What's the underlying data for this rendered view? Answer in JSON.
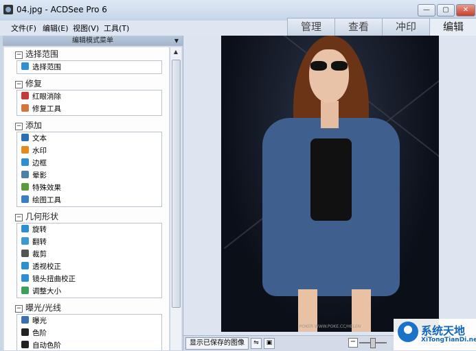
{
  "window": {
    "title": "04.jpg - ACDSee Pro 6",
    "minimize": "—",
    "maximize": "▢",
    "close": "✕"
  },
  "menu": [
    "文件(F)",
    "编辑(E)",
    "视图(V)",
    "工具(T)"
  ],
  "mode_tabs": [
    "管理",
    "查看",
    "冲印",
    "编辑"
  ],
  "active_mode": "编辑",
  "panel": {
    "title": "编辑模式菜单",
    "sections": [
      {
        "title": "选择范围",
        "tools": [
          {
            "label": "选择范围",
            "icon": "selection-icon",
            "color": "#2c8fd1"
          }
        ]
      },
      {
        "title": "修复",
        "tools": [
          {
            "label": "红眼消除",
            "icon": "eye-icon",
            "color": "#c63a3a"
          },
          {
            "label": "修复工具",
            "icon": "bandage-icon",
            "color": "#d4763a"
          }
        ]
      },
      {
        "title": "添加",
        "tools": [
          {
            "label": "文本",
            "icon": "text-icon",
            "color": "#2a6fb5"
          },
          {
            "label": "水印",
            "icon": "watermark-icon",
            "color": "#e58b1e"
          },
          {
            "label": "边框",
            "icon": "border-icon",
            "color": "#2c8fd1"
          },
          {
            "label": "晕影",
            "icon": "vignette-icon",
            "color": "#4a7fa8"
          },
          {
            "label": "特殊效果",
            "icon": "effects-icon",
            "color": "#5b9b3a"
          },
          {
            "label": "绘图工具",
            "icon": "drawing-icon",
            "color": "#3a7fc4"
          }
        ]
      },
      {
        "title": "几何形状",
        "tools": [
          {
            "label": "旋转",
            "icon": "rotate-icon",
            "color": "#2c8fd1"
          },
          {
            "label": "翻转",
            "icon": "flip-icon",
            "color": "#3a9bd1"
          },
          {
            "label": "裁剪",
            "icon": "crop-icon",
            "color": "#555555"
          },
          {
            "label": "透视校正",
            "icon": "perspective-icon",
            "color": "#2c8fd1"
          },
          {
            "label": "镜头扭曲校正",
            "icon": "lens-icon",
            "color": "#2c8fd1"
          },
          {
            "label": "调整大小",
            "icon": "resize-icon",
            "color": "#3aa05a"
          }
        ]
      },
      {
        "title": "曝光/光线",
        "tools": [
          {
            "label": "曝光",
            "icon": "exposure-icon",
            "color": "#3a6fb0"
          },
          {
            "label": "色阶",
            "icon": "levels-icon",
            "color": "#222222"
          },
          {
            "label": "自动色阶",
            "icon": "auto-levels-icon",
            "color": "#222222"
          }
        ]
      }
    ]
  },
  "status": {
    "show_saved": "显示已保存的图像",
    "zoom_minus": "−"
  },
  "photo_caption": "POKER WWW.POKE.CC/HELEN",
  "watermark": {
    "name": "系统天地",
    "url": "XiTongTianDi.net"
  }
}
